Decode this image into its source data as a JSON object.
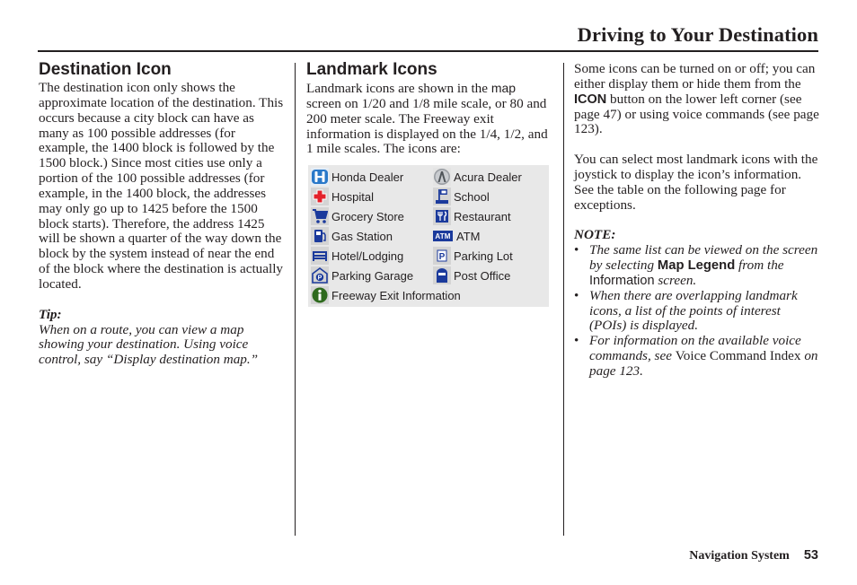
{
  "header": {
    "title": "Driving to Your Destination"
  },
  "destination_icon": {
    "heading": "Destination Icon",
    "body": "The destination icon only shows the approximate location of the destination. This occurs because a city block can have as many as 100 possible addresses (for example, the 1400 block is followed by the 1500 block.) Since most cities use only a portion of the 100 possible addresses (for example, in the 1400 block, the addresses may only go up to 1425 before the 1500 block starts). Therefore, the address 1425 will be shown a quarter of the way down the block by the system instead of near the end of the block where the destination is actually located.",
    "tip_label": "Tip:",
    "tip_text": "When on a route, you can view a map showing your destination. Using voice control, say “Display destination map.”"
  },
  "landmark_icons": {
    "heading": "Landmark Icons",
    "intro_pre": "Landmark icons are shown in the ",
    "intro_map": "map",
    "intro_post": " screen on 1/20 and 1/8 mile scale, or 80 and 200 meter scale. The Freeway exit information is displayed on the 1/4, 1/2, and 1 mile scales. The icons are:",
    "icons": [
      {
        "label": "Honda Dealer",
        "icon": "honda-logo-icon"
      },
      {
        "label": "Acura Dealer",
        "icon": "acura-logo-icon"
      },
      {
        "label": "Hospital",
        "icon": "red-cross-icon"
      },
      {
        "label": "School",
        "icon": "flag-icon"
      },
      {
        "label": "Grocery Store",
        "icon": "shopping-cart-icon"
      },
      {
        "label": "Restaurant",
        "icon": "fork-knife-icon"
      },
      {
        "label": "Gas Station",
        "icon": "gas-pump-icon"
      },
      {
        "label": "ATM",
        "icon": "atm-icon"
      },
      {
        "label": "Hotel/Lodging",
        "icon": "bed-icon"
      },
      {
        "label": "Parking Lot",
        "icon": "parking-p-icon"
      },
      {
        "label": "Parking Garage",
        "icon": "parking-garage-icon"
      },
      {
        "label": "Post Office",
        "icon": "mailbox-icon"
      },
      {
        "label": "Freeway Exit Information",
        "icon": "info-icon"
      }
    ],
    "atm_text": "ATM"
  },
  "right_column": {
    "para1_pre": "Some icons can be turned on or off; you can either display them or hide them from the ",
    "para1_button": "ICON",
    "para1_post": " button on the lower left corner (see page 47) or using voice commands (see page 123).",
    "para2": "You can select most landmark icons with the joystick to display the icon’s information. See the table on the following page for exceptions.",
    "note_label": "NOTE:",
    "notes": [
      {
        "pre": "The same list can be viewed on the screen by selecting ",
        "bold": "Map Legend",
        "mid": " from the ",
        "sans": "Information",
        "post": " screen."
      },
      {
        "text": "When there are overlapping landmark icons, a list of the points of interest (POIs) is displayed."
      },
      {
        "pre": "For information on the available voice commands, see ",
        "upright": "Voice Command Index",
        "post": " on page 123."
      }
    ]
  },
  "footer": {
    "label": "Navigation System",
    "page": "53"
  },
  "colors": {
    "text": "#231f20",
    "icon_table_bg": "#e8e8e8",
    "icon_bg": "#d4d4d4",
    "icon_blue": "#1b3a9c",
    "hospital_red": "#e3222b",
    "info_green": "#2e6a1e"
  }
}
